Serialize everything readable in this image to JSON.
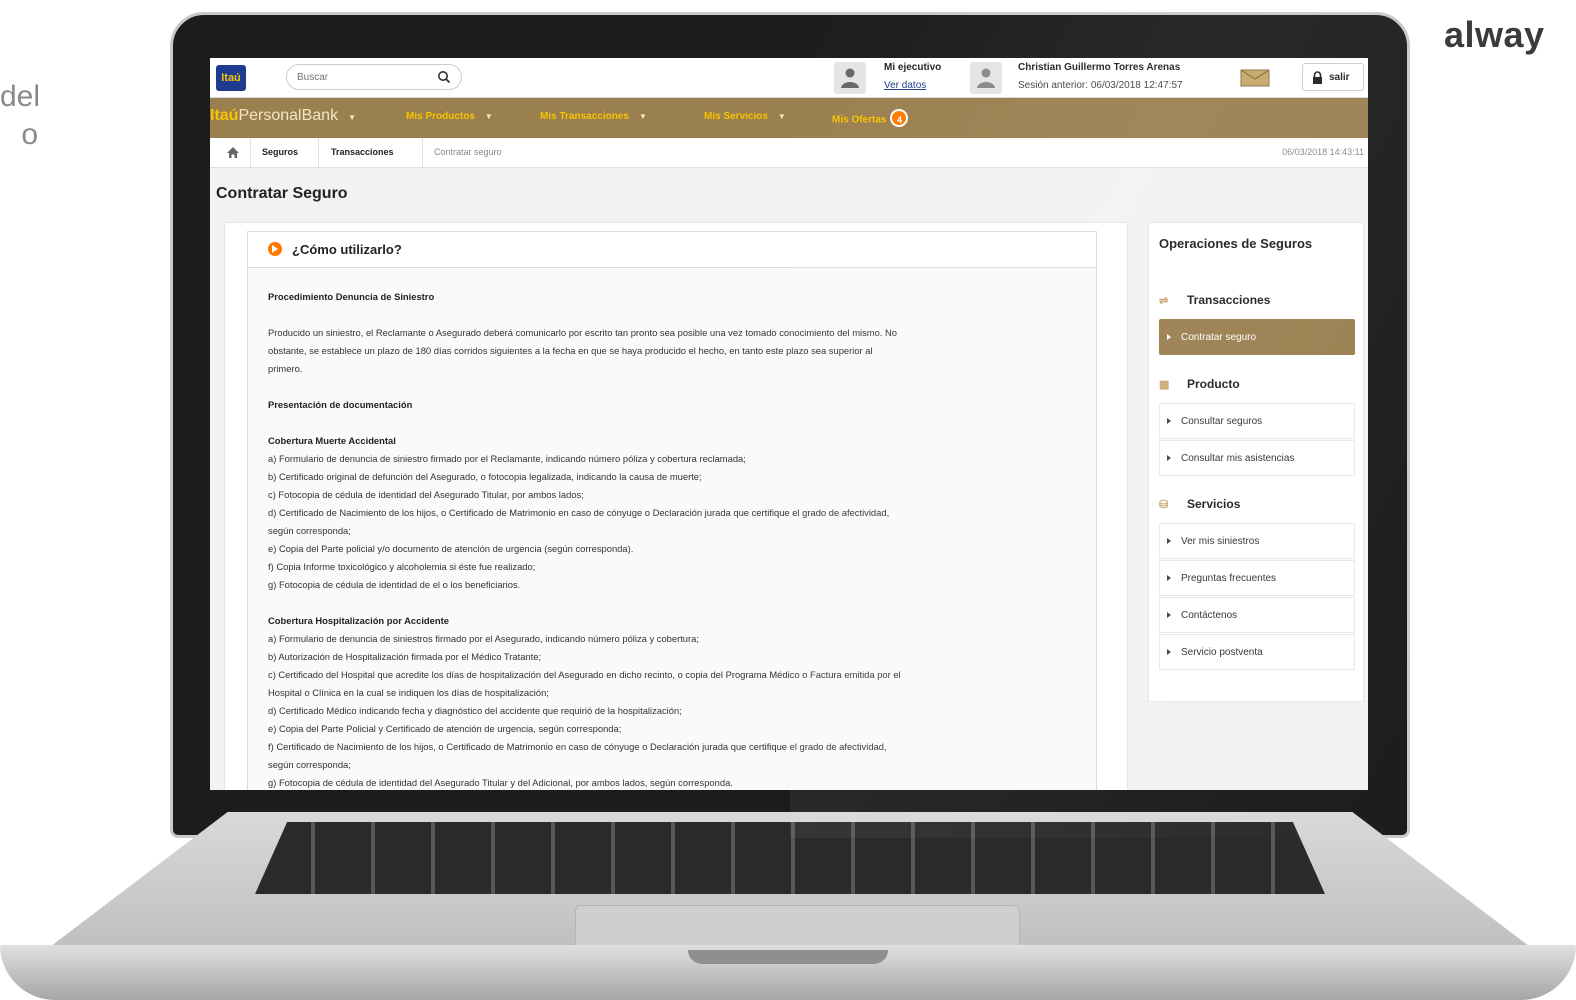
{
  "slide": {
    "side_text_lines": [
      "del",
      "o"
    ],
    "brand_tag": "alway"
  },
  "topbar": {
    "logo_text": "Itaú",
    "search_placeholder": "Buscar",
    "executive_title": "Mi ejecutivo",
    "executive_link": "Ver datos",
    "user_name": "Christian Guillermo Torres Arenas",
    "previous_session": "Sesión anterior: 06/03/2018 12:47:57",
    "logout_label": "salir"
  },
  "nav": {
    "brand_bold": "Itaú",
    "brand_rest": "PersonalBank",
    "items": [
      {
        "label": "Mis Productos"
      },
      {
        "label": "Mis Transacciones"
      },
      {
        "label": "Mis Servicios"
      },
      {
        "label": "Mis Ofertas"
      }
    ],
    "offers_count": "4"
  },
  "breadcrumb": {
    "items": [
      "Seguros",
      "Transacciones",
      "Contratar seguro"
    ],
    "timestamp": "06/03/2018 14:43:11"
  },
  "page": {
    "title": "Contratar Seguro"
  },
  "howto": {
    "title": "¿Cómo utilizarlo?",
    "procedure_heading": "Procedimiento Denuncia de Siniestro",
    "procedure_text": [
      "Producido un siniestro, el Reclamante o Asegurado deberá comunicarlo por escrito tan pronto sea posible una vez tomado conocimiento del mismo. No",
      "obstante, se establece un plazo de 180 días corridos siguientes a la fecha en que se haya producido el hecho, en tanto este plazo sea superior al",
      "primero."
    ],
    "docs_heading": "Presentación de documentación",
    "death_heading": "Cobertura Muerte Accidental",
    "death_items": [
      "a) Formulario de denuncia de siniestro firmado por el Reclamante, indicando número póliza y cobertura reclamada;",
      "b) Certificado original de defunción del Asegurado, o fotocopia legalizada, indicando la causa de muerte;",
      "c) Fotocopia de cédula de identidad del Asegurado Titular, por ambos lados;",
      "d) Certificado de Nacimiento de los hijos, o Certificado de Matrimonio en caso de cónyuge o Declaración jurada que certifique el grado de afectividad,",
      "según corresponda;",
      "e) Copia del Parte policial y/o documento de atención de urgencia (según corresponda).",
      "f) Copia Informe toxicológico y alcoholemia si éste fue realizado;",
      "g) Fotocopia de cédula de identidad de el o los beneficiarios."
    ],
    "hosp_heading": "Cobertura Hospitalización por Accidente",
    "hosp_items": [
      "a) Formulario de denuncia de siniestros firmado por el Asegurado, indicando número póliza y cobertura;",
      "b) Autorización de Hospitalización firmada por el Médico Tratante;",
      "c) Certificado del Hospital que acredite los días de hospitalización del Asegurado en dicho recinto, o copia del Programa Médico o Factura emitida por el",
      "Hospital o Clínica en la cual se indiquen los días de hospitalización;",
      "d) Certificado Médico indicando fecha y diagnóstico del accidente que requirió de la hospitalización;",
      "e) Copia del Parte Policial y Certificado de atención de urgencia, según corresponda;",
      "f) Certificado de Nacimiento de los hijos, o Certificado de Matrimonio en caso de cónyuge o Declaración jurada que certifique el grado de afectividad,",
      "según corresponda;",
      "g) Fotocopia de cédula de identidad del Asegurado Titular y del Adicional, por ambos lados, según corresponda."
    ]
  },
  "sidebar": {
    "title": "Operaciones de Seguros",
    "sections": [
      {
        "label": "Transacciones",
        "icon": "transfer-icon"
      },
      {
        "label": "Producto",
        "icon": "grid-icon"
      },
      {
        "label": "Servicios",
        "icon": "service-bell-icon"
      }
    ],
    "transacciones_items": [
      "Contratar seguro"
    ],
    "producto_items": [
      "Consultar seguros",
      "Consultar mis asistencias"
    ],
    "servicios_items": [
      "Ver mis siniestros",
      "Preguntas frecuentes",
      "Contáctenos",
      "Servicio postventa"
    ]
  },
  "colors": {
    "nav_gold": "#9a7f4f",
    "nav_text_yellow": "#f7c400",
    "accent_orange": "#ff7a00",
    "itau_blue": "#1d3b8f"
  }
}
